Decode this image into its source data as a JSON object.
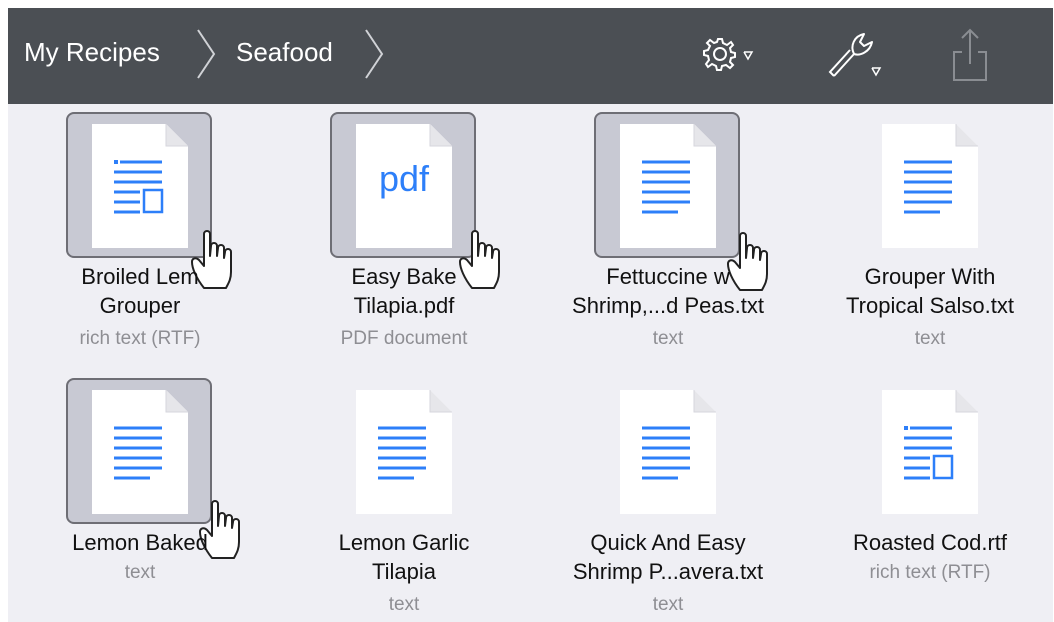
{
  "toolbar": {
    "breadcrumb": [
      "My Recipes",
      "Seafood"
    ],
    "icons": [
      "settings-gear-icon",
      "wrench-icon",
      "share-icon"
    ]
  },
  "files": [
    {
      "title_line1": "Broiled Lem",
      "title_line2": "Grouper",
      "kind": "rich text (RTF)",
      "icon": "rtf-doc-icon",
      "selected": true,
      "hand": true
    },
    {
      "title_line1": "Easy Bake",
      "title_line2": "Tilapia.pdf",
      "kind": "PDF document",
      "icon": "pdf-doc-icon",
      "badge": "pdf",
      "selected": true,
      "hand": true
    },
    {
      "title_line1": "Fettuccine w",
      "title_line2": "Shrimp,...d Peas.txt",
      "kind": "text",
      "icon": "text-doc-icon",
      "selected": true,
      "hand": true
    },
    {
      "title_line1": "Grouper With",
      "title_line2": "Tropical Salso.txt",
      "kind": "text",
      "icon": "text-doc-icon",
      "selected": false,
      "hand": false
    },
    {
      "title_line1": "Lemon Baked",
      "title_line2": "",
      "kind": "text",
      "icon": "text-doc-icon",
      "selected": true,
      "hand": true
    },
    {
      "title_line1": "Lemon Garlic",
      "title_line2": "Tilapia",
      "kind": "text",
      "icon": "text-doc-icon",
      "selected": false,
      "hand": false
    },
    {
      "title_line1": "Quick And Easy",
      "title_line2": "Shrimp P...avera.txt",
      "kind": "text",
      "icon": "text-doc-icon",
      "selected": false,
      "hand": false
    },
    {
      "title_line1": "Roasted Cod.rtf",
      "title_line2": "",
      "kind": "rich text (RTF)",
      "icon": "rtf-doc-icon",
      "selected": false,
      "hand": false
    }
  ],
  "colors": {
    "toolbar": "#4b4f54",
    "accent": "#2d7ff9",
    "background": "#efeff4",
    "selection": "#c8c9d3"
  }
}
